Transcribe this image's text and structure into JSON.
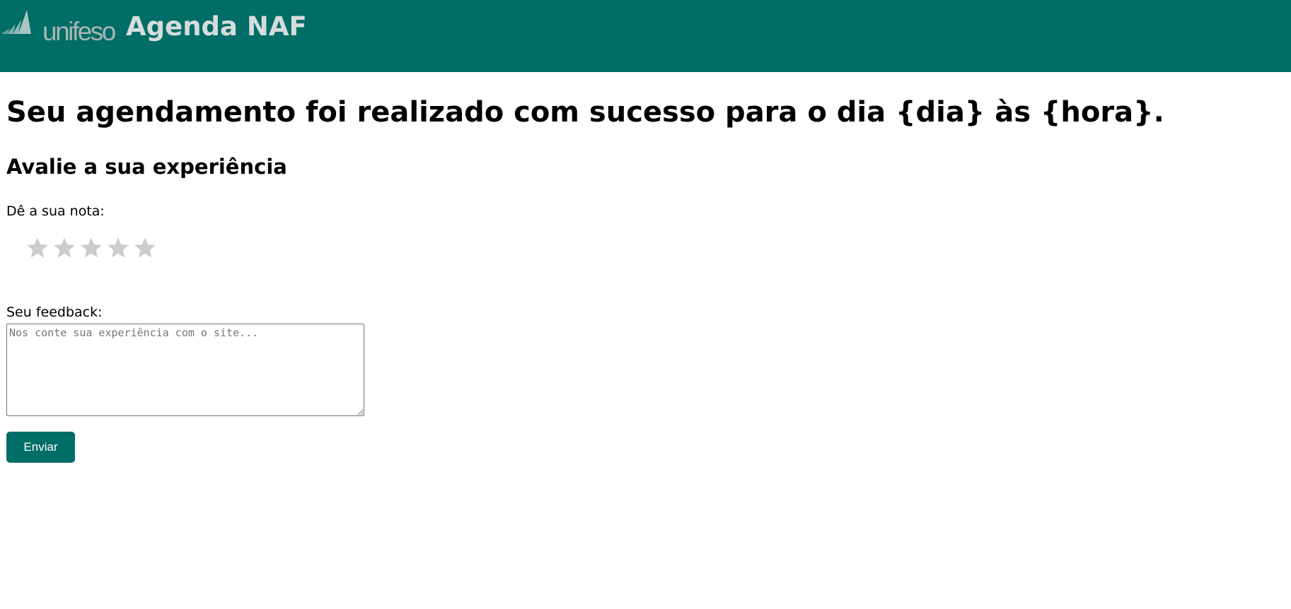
{
  "header": {
    "logo_text": "unifeso",
    "app_title": "Agenda NAF",
    "background_color": "#006d66"
  },
  "main": {
    "success_message": "Seu agendamento foi realizado com sucesso para o dia {dia} às {hora}.",
    "rating_section": {
      "heading": "Avalie a sua experiência",
      "label": "Dê a sua nota:",
      "max_stars": 5,
      "selected_stars": 0,
      "star_color": "#cccccc"
    },
    "feedback": {
      "label": "Seu feedback:",
      "value": "",
      "placeholder": "Nos conte sua experiência com o site..."
    },
    "submit_label": "Enviar",
    "accent_color": "#006d66"
  },
  "icons": {
    "logo": "unifeso-logo-icon",
    "star": "star-icon",
    "resize": "resize-handle-icon"
  }
}
